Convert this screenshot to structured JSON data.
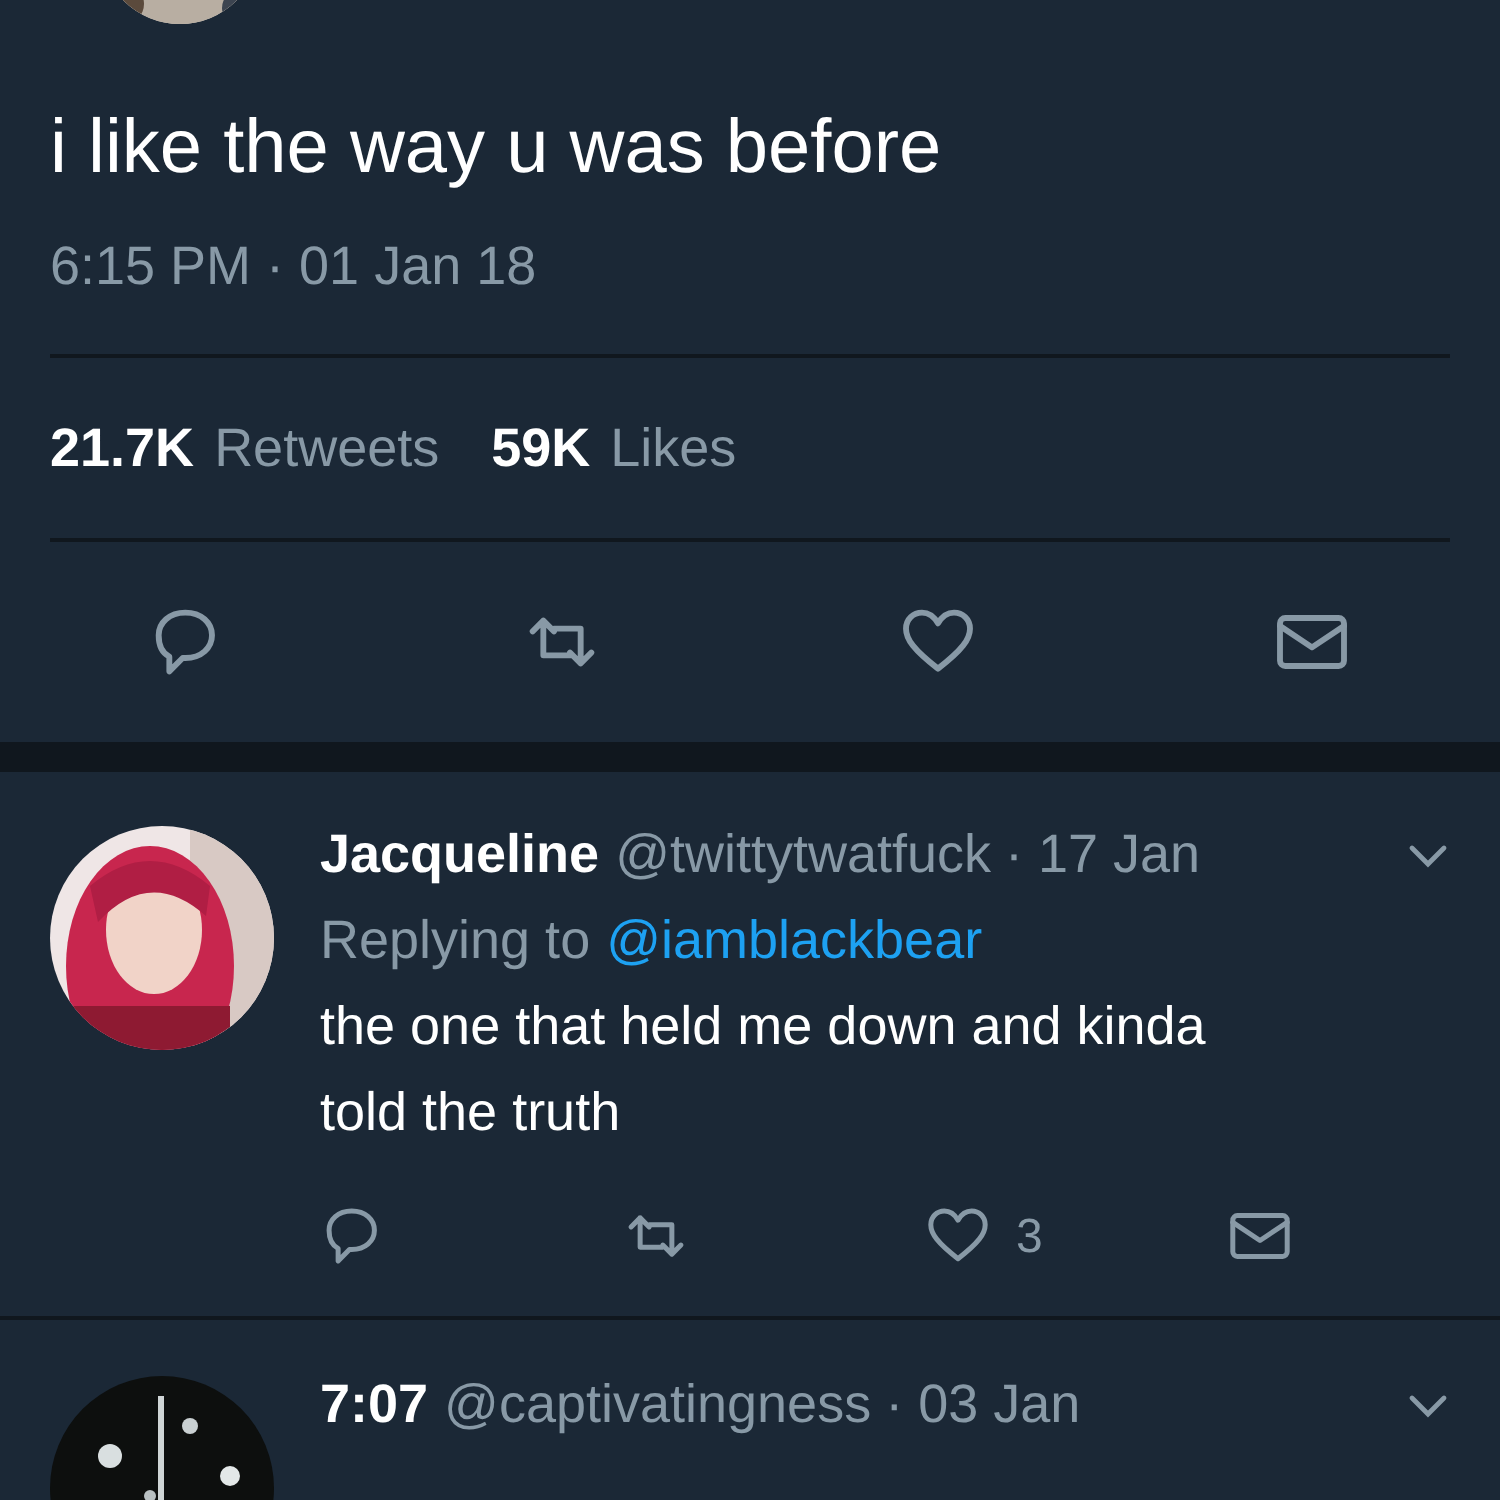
{
  "tweet": {
    "text": "i like the way u was before",
    "timestamp": "6:15 PM · 01 Jan 18",
    "stats": [
      {
        "count": "21.7K",
        "label": "Retweets"
      },
      {
        "count": "59K",
        "label": "Likes"
      }
    ]
  },
  "replies": [
    {
      "name": "Jacqueline",
      "handle": "@twittytwatfuck",
      "date": "· 17 Jan",
      "replying_label": "Replying to",
      "replying_handle": "@iamblackbear",
      "text": "the one that held me down and kinda told the truth",
      "likes": "3"
    },
    {
      "name": "7:07",
      "handle": "@captivatingness",
      "date": "· 03 Jan"
    }
  ]
}
